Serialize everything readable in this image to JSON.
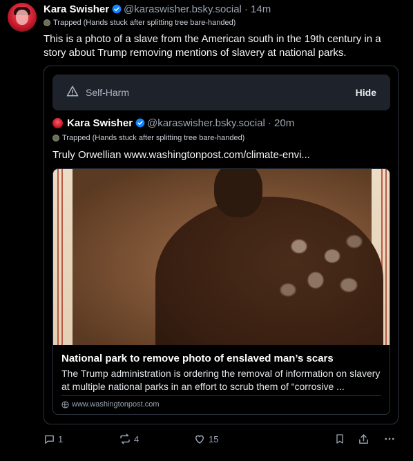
{
  "post": {
    "author_name": "Kara Swisher",
    "author_handle": "@karaswisher.bsky.social",
    "timestamp": "· 14m",
    "badge": "Trapped (Hands stuck after splitting tree bare-handed)",
    "text": "This is a photo of a slave from the American south in the 19th century in a story about Trump removing mentions of slavery at national parks."
  },
  "quote": {
    "warning_label": "Self-Harm",
    "hide_label": "Hide",
    "author_name": "Kara Swisher",
    "author_handle": "@karaswisher.bsky.social",
    "timestamp": "· 20m",
    "badge": "Trapped (Hands stuck after splitting tree bare-handed)",
    "text": "Truly Orwellian www.washingtonpost.com/climate-envi...",
    "card": {
      "title": "National park to remove photo of enslaved man’s scars",
      "description": "The Trump administration is ordering the removal of information on slavery at multiple national parks in an effort to scrub them of “corrosive ...",
      "domain": "www.washingtonpost.com"
    }
  },
  "actions": {
    "replies": "1",
    "reposts": "4",
    "likes": "15"
  },
  "colors": {
    "background": "#000000",
    "verified": "#1083fe",
    "muted": "#9aa4b2"
  }
}
